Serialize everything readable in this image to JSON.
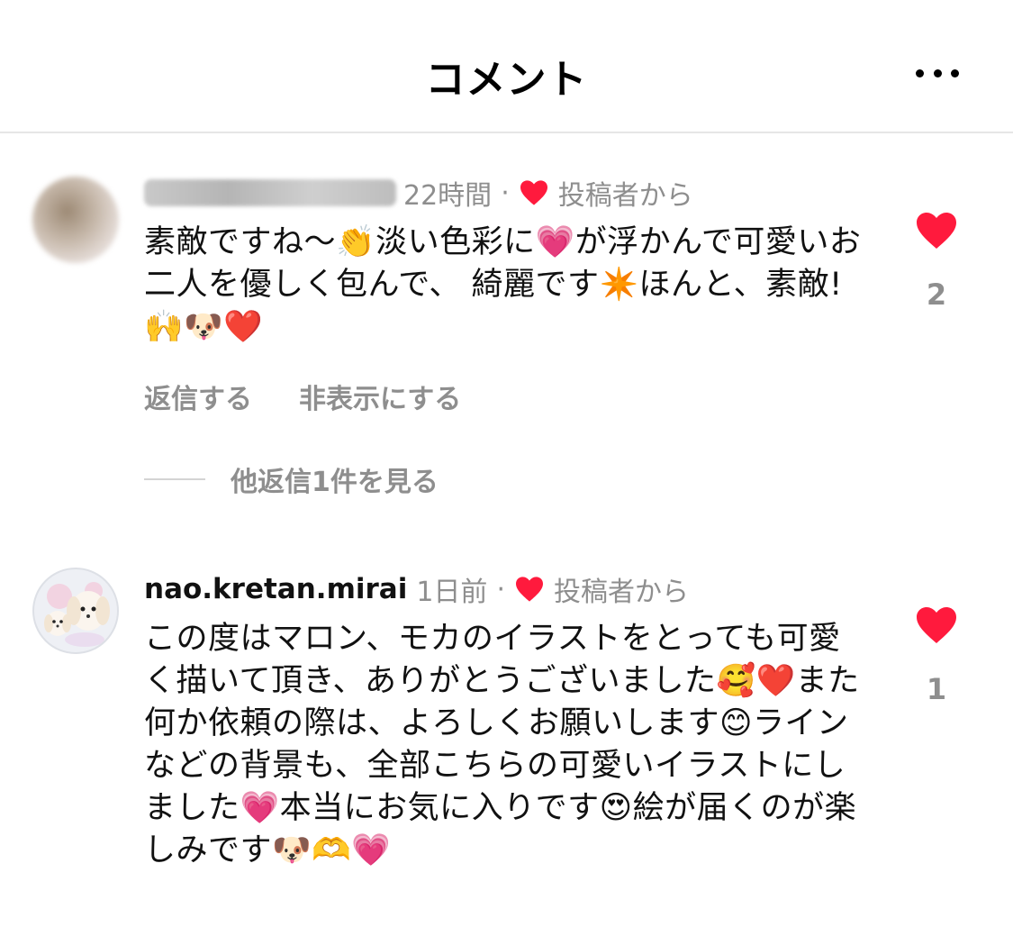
{
  "header": {
    "title": "コメント",
    "more_icon": "more-horizontal-icon"
  },
  "comments": [
    {
      "username": "kawashimamiwi",
      "time": "22時間",
      "creator_label": "投稿者から",
      "text": "素敵ですね〜👏淡い色彩に💗が浮かんで可愛いお二人を優しく包んで、 綺麗です✴️ほんと、素敵!🙌🐶❤️",
      "reply_label": "返信する",
      "hide_label": "非表示にする",
      "likes": "2",
      "view_replies": "他返信1件を見る"
    },
    {
      "username": "nao.kretan.mirai",
      "time": "1日前",
      "creator_label": "投稿者から",
      "text": "この度はマロン、モカのイラストをとっても可愛く描いて頂き、ありがとうございました🥰❤️また何か依頼の際は、よろしくお願いします😊ラインなどの背景も、全部こちらの可愛いイラストにしました💗本当にお気に入りです😍絵が届くのが楽しみです🐶🫶💗",
      "likes": "1"
    }
  ],
  "colors": {
    "heart": "#ff1a3d",
    "gray": "#8e8e8e",
    "divider": "#e6e6e6"
  }
}
